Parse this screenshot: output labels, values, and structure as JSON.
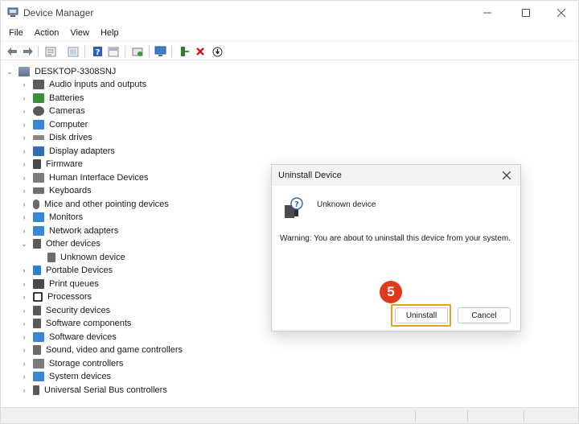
{
  "window": {
    "title": "Device Manager",
    "icons": {
      "app": "device-manager-icon",
      "minimize": "minimize-icon",
      "maximize": "maximize-icon",
      "close": "close-icon"
    }
  },
  "menu": {
    "items": [
      "File",
      "Action",
      "View",
      "Help"
    ]
  },
  "toolbar": {
    "buttons": [
      "back-arrow-icon",
      "forward-arrow-icon",
      "properties-icon",
      "scan-hardware-icon",
      "help-icon",
      "view-icon",
      "update-driver-icon",
      "monitor-icon",
      "enable-device-icon",
      "uninstall-device-x-icon",
      "download-icon"
    ],
    "colors": {
      "uninstall_x": "#d0131b",
      "help": "#2f5fb3"
    }
  },
  "tree": {
    "root": "DESKTOP-3308SNJ",
    "categories": [
      "Audio inputs and outputs",
      "Batteries",
      "Cameras",
      "Computer",
      "Disk drives",
      "Display adapters",
      "Firmware",
      "Human Interface Devices",
      "Keyboards",
      "Mice and other pointing devices",
      "Monitors",
      "Network adapters",
      "Other devices",
      "Unknown device",
      "Portable Devices",
      "Print queues",
      "Processors",
      "Security devices",
      "Software components",
      "Software devices",
      "Sound, video and game controllers",
      "Storage controllers",
      "System devices",
      "Universal Serial Bus controllers"
    ],
    "expanded": "Other devices"
  },
  "dialog": {
    "title": "Uninstall Device",
    "device_name": "Unknown device",
    "warning": "Warning: You are about to uninstall this device from your system.",
    "uninstall_label": "Uninstall",
    "cancel_label": "Cancel",
    "step_number": "5",
    "highlight_color": "#e0a11b",
    "badge_color": "#e03a1e"
  }
}
